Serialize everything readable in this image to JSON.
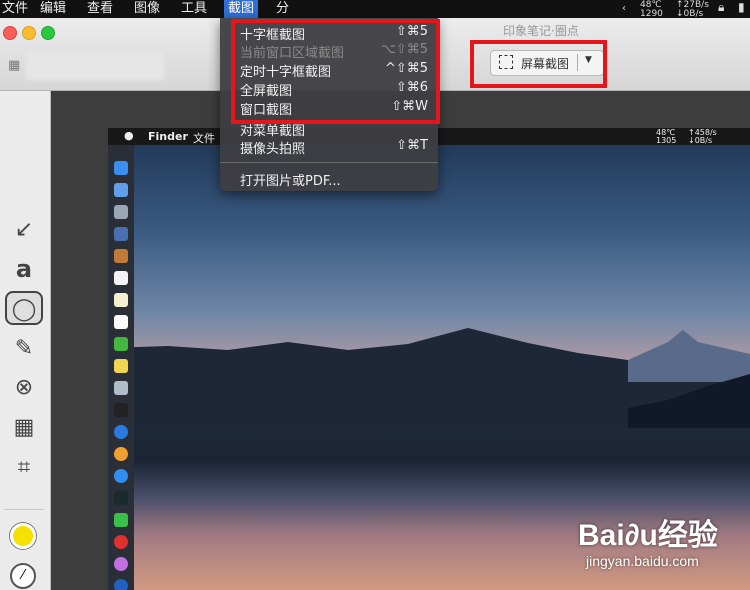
{
  "menubar": {
    "items": [
      "文件",
      "编辑",
      "查看",
      "图像",
      "工具",
      "截图",
      "分"
    ],
    "active_index": 5,
    "status": {
      "temp": "48℃",
      "rpm": "1290",
      "up": "↑27B/s",
      "down": "↓0B/s"
    }
  },
  "window": {
    "title": "印象笔记·圈点"
  },
  "toolbar": {
    "screen_capture_label": "屏幕截图",
    "dropdown_arrow": "▼"
  },
  "menu": {
    "items": [
      {
        "label": "十字框截图",
        "shortcut": "⇧⌘5",
        "enabled": true
      },
      {
        "label": "当前窗口区域截图",
        "shortcut": "⌥⇧⌘5",
        "enabled": false
      },
      {
        "label": "定时十字框截图",
        "shortcut": "^⇧⌘5",
        "enabled": true
      },
      {
        "label": "全屏截图",
        "shortcut": "⇧⌘6",
        "enabled": true
      },
      {
        "label": "窗口截图",
        "shortcut": "⇧⌘W",
        "enabled": true
      },
      {
        "label": "对菜单截图",
        "shortcut": "",
        "enabled": true
      },
      {
        "label": "摄像头拍照",
        "shortcut": "⇧⌘T",
        "enabled": true
      },
      {
        "label": "打开图片或PDF...",
        "shortcut": "",
        "enabled": true
      }
    ]
  },
  "sidebar": {
    "tools": [
      {
        "name": "arrow-tool",
        "glyph": "↙"
      },
      {
        "name": "text-tool",
        "glyph": "a"
      },
      {
        "name": "ellipse-tool",
        "glyph": "◯"
      },
      {
        "name": "marker-tool",
        "glyph": "✎"
      },
      {
        "name": "eraser-tool",
        "glyph": "⊗"
      },
      {
        "name": "pixelate-tool",
        "glyph": "▦"
      },
      {
        "name": "crop-tool",
        "glyph": "⌗"
      }
    ],
    "selected_index": 2,
    "color": "#f5e000"
  },
  "screenshot": {
    "finder_menu": [
      "Finder",
      "文件"
    ],
    "status": {
      "temp": "48℃",
      "rpm": "1305",
      "up": "↑458/s",
      "down": "↓0B/s"
    }
  },
  "watermark": {
    "brand": "Bai∂u经验",
    "url": "jingyan.baidu.com"
  },
  "colors": {
    "accent": "#2f6fd6",
    "highlight": "#e4161b"
  }
}
